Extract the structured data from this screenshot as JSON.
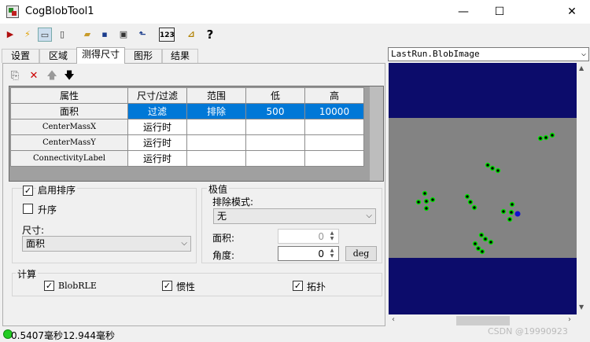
{
  "window": {
    "title": "CogBlobTool1",
    "minimize": "—",
    "maximize": "☐",
    "close": "✕"
  },
  "toolbar": [
    {
      "name": "run-icon",
      "glyph": "▶",
      "color": "#b01010"
    },
    {
      "name": "lightning-icon",
      "glyph": "⚡",
      "color": "#e0a000"
    },
    {
      "name": "electronic-mode-icon",
      "glyph": "▭",
      "color": "#333"
    },
    {
      "name": "reset-icon",
      "glyph": "▯",
      "color": "#333"
    },
    {
      "name": "open-folder-icon",
      "glyph": "▰",
      "color": "#c89b2a"
    },
    {
      "name": "save-icon",
      "glyph": "▪",
      "color": "#1a3c8c"
    },
    {
      "name": "import-icon",
      "glyph": "▣",
      "color": "#333"
    },
    {
      "name": "export-icon",
      "glyph": "⬑",
      "color": "#1a3c8c"
    },
    {
      "name": "numeric-icon",
      "glyph": "123",
      "color": "#000"
    },
    {
      "name": "ruler-icon",
      "glyph": "⊿",
      "color": "#b08000"
    },
    {
      "name": "help-icon",
      "glyph": "?",
      "color": "#000"
    }
  ],
  "tabs": [
    "设置",
    "区域",
    "测得尺寸",
    "图形",
    "结果"
  ],
  "grid_toolbar": [
    {
      "name": "new-row-icon",
      "glyph": "⎘"
    },
    {
      "name": "delete-icon",
      "glyph": "✕"
    },
    {
      "name": "move-up-icon",
      "glyph": "🡅"
    },
    {
      "name": "move-down-icon",
      "glyph": "🡇"
    }
  ],
  "grid": {
    "headers": [
      "属性",
      "尺寸/过滤",
      "范围",
      "低",
      "高"
    ],
    "rows": [
      [
        "面积",
        "过滤",
        "排除",
        "500",
        "10000"
      ],
      [
        "CenterMassX",
        "运行时",
        "",
        "",
        ""
      ],
      [
        "CenterMassY",
        "运行时",
        "",
        "",
        ""
      ],
      [
        "ConnectivityLabel",
        "运行时",
        "",
        "",
        ""
      ]
    ]
  },
  "sort": {
    "enable_label": "启用排序",
    "enable_checked": "✓",
    "ascending_label": "升序",
    "size_label": "尺寸:",
    "size_value": "面积"
  },
  "extremes": {
    "group_label": "极值",
    "exclude_mode_label": "排除模式:",
    "exclude_mode_value": "无",
    "area_label": "面积:",
    "area_value": "0",
    "angle_label": "角度:",
    "angle_value": "0",
    "deg_button": "deg"
  },
  "compute": {
    "group_label": "计算",
    "items": [
      {
        "label": "BlobRLE",
        "checked": "✓"
      },
      {
        "label": "惯性",
        "checked": "✓"
      },
      {
        "label": "拓扑",
        "checked": "✓"
      }
    ]
  },
  "status": {
    "text": "0.5407毫秒12.944毫秒"
  },
  "image_view": {
    "selector_value": "LastRun.BlobImage",
    "dark_color": "#0c0c6b",
    "gray_color": "#838383"
  },
  "watermark": "CSDN @19990923"
}
